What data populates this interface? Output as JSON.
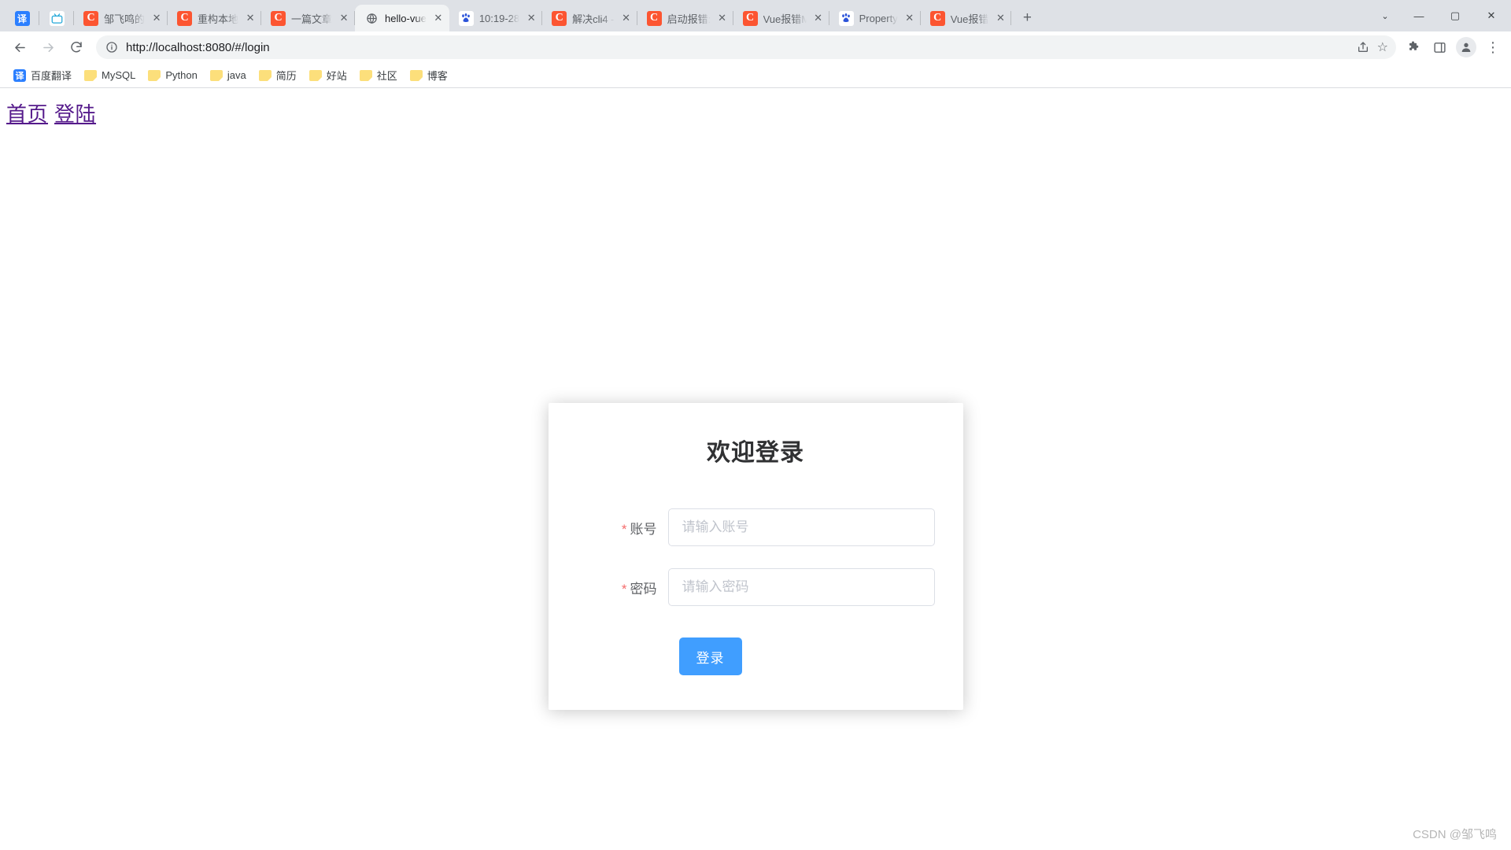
{
  "browser": {
    "pinned_tabs": [
      {
        "name": "translate-pinned-tab",
        "icon": "translate-icon",
        "glyph": "译"
      },
      {
        "name": "bilibili-pinned-tab",
        "icon": "bilibili-icon",
        "glyph": "҉"
      }
    ],
    "tabs": [
      {
        "title": "邹飞鸣的",
        "icon": "csdn-icon",
        "glyph": "C",
        "icon_kind": "csdn",
        "active": false
      },
      {
        "title": "重构本地",
        "icon": "csdn-icon",
        "glyph": "C",
        "icon_kind": "csdn",
        "active": false
      },
      {
        "title": "一篇文章",
        "icon": "csdn-icon",
        "glyph": "C",
        "icon_kind": "csdn",
        "active": false
      },
      {
        "title": "hello-vue",
        "icon": "globe-icon",
        "glyph": "ἱ0",
        "icon_kind": "globe",
        "active": true
      },
      {
        "title": "10:19-28",
        "icon": "baidu-icon",
        "glyph": "百",
        "icon_kind": "baidu",
        "active": false
      },
      {
        "title": "解决cli4 -",
        "icon": "csdn-icon",
        "glyph": "C",
        "icon_kind": "csdn",
        "active": false
      },
      {
        "title": "启动报错:",
        "icon": "csdn-icon",
        "glyph": "C",
        "icon_kind": "csdn",
        "active": false
      },
      {
        "title": "Vue报错M",
        "icon": "csdn-icon",
        "glyph": "C",
        "icon_kind": "csdn",
        "active": false
      },
      {
        "title": "Property",
        "icon": "baidu-icon",
        "glyph": "百",
        "icon_kind": "baidu",
        "active": false
      },
      {
        "title": "Vue报错",
        "icon": "csdn-icon",
        "glyph": "C",
        "icon_kind": "csdn",
        "active": false
      }
    ],
    "new_tab_label": "+",
    "tab_close_label": "✕",
    "window_controls": {
      "tab_search": "⌄",
      "minimize": "—",
      "maximize": "▢",
      "close": "✕"
    },
    "toolbar": {
      "back": "←",
      "forward": "→",
      "reload": "⟳",
      "site_info_icon": "info-circle-icon",
      "url": "http://localhost:8080/#/login",
      "share_icon": "share-icon",
      "bookmark_star": "☆",
      "extensions_icon": "puzzle-icon",
      "sidepanel_icon": "side-panel-icon",
      "profile_icon": "person-icon",
      "menu_icon": "⋮"
    },
    "bookmarks": [
      {
        "label": "百度翻译",
        "icon": "translate-icon",
        "kind": "translate"
      },
      {
        "label": "MySQL",
        "icon": "folder-icon",
        "kind": "folder"
      },
      {
        "label": "Python",
        "icon": "folder-icon",
        "kind": "folder"
      },
      {
        "label": "java",
        "icon": "folder-icon",
        "kind": "folder"
      },
      {
        "label": "简历",
        "icon": "folder-icon",
        "kind": "folder"
      },
      {
        "label": "好站",
        "icon": "folder-icon",
        "kind": "folder"
      },
      {
        "label": "社区",
        "icon": "folder-icon",
        "kind": "folder"
      },
      {
        "label": "博客",
        "icon": "folder-icon",
        "kind": "folder"
      }
    ]
  },
  "page": {
    "nav_links": [
      {
        "label": "首页"
      },
      {
        "label": "登陆"
      }
    ],
    "login": {
      "title": "欢迎登录",
      "required_marker": "*",
      "fields": [
        {
          "label": "账号",
          "placeholder": "请输入账号",
          "value": "",
          "type": "text",
          "name": "username"
        },
        {
          "label": "密码",
          "placeholder": "请输入密码",
          "value": "",
          "type": "password",
          "name": "password"
        }
      ],
      "submit_label": "登录",
      "accent_color": "#409eff",
      "required_color": "#f56c6c"
    },
    "watermark": "CSDN @邹飞鸣"
  }
}
